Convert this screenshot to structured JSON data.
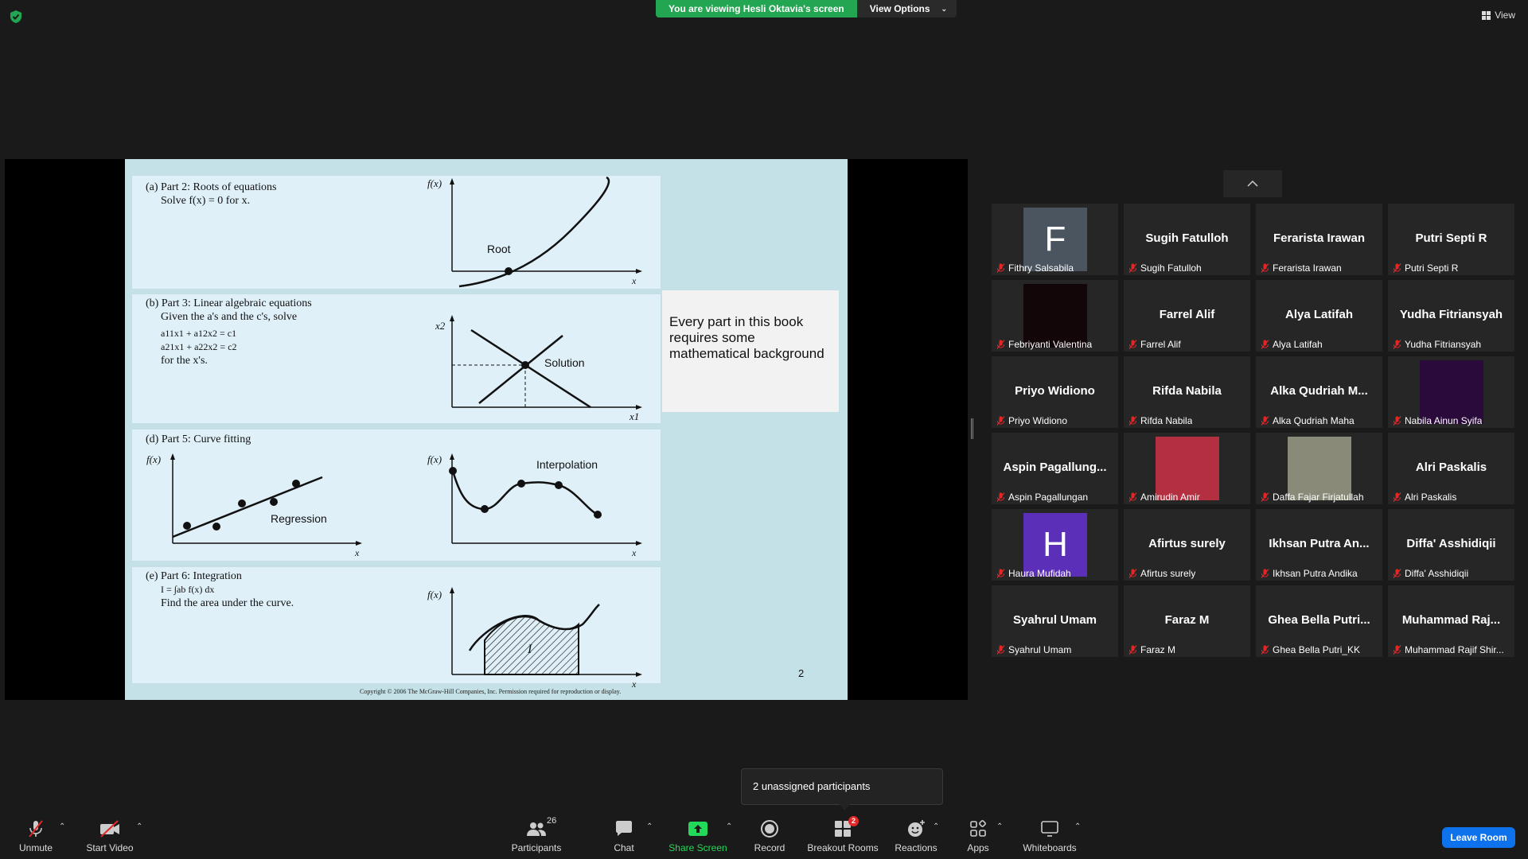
{
  "top": {
    "banner": "You are viewing Hesli Oktavia's screen",
    "view_options": "View Options",
    "view": "View"
  },
  "slide": {
    "part_a_title": "(a) Part 2: Roots of equations",
    "part_a_body": "Solve f(x) = 0 for x.",
    "part_a_label": "Root",
    "part_b_title": "(b) Part 3: Linear algebraic equations",
    "part_b_body1": "Given the a's and the c's, solve",
    "part_b_eq1": "a11x1 + a12x2 = c1",
    "part_b_eq2": "a21x1 + a22x2 = c2",
    "part_b_body2": "for the x's.",
    "part_b_label": "Solution",
    "part_d_title": "(d) Part 5: Curve fitting",
    "part_d_label_reg": "Regression",
    "part_d_label_int": "Interpolation",
    "part_e_title": "(e) Part 6: Integration",
    "part_e_eq": "I = ∫ab f(x) dx",
    "part_e_body": "Find the area under the curve.",
    "part_e_label": "I",
    "axis_fx": "f(x)",
    "axis_x": "x",
    "axis_x1": "x1",
    "axis_x2": "x2",
    "note": "Every part in this book requires some mathematical background",
    "page": "2",
    "copyright": "Copyright © 2006 The McGraw-Hill Companies, Inc.  Permission required for reproduction or display."
  },
  "participants": [
    {
      "big": "",
      "label": "Fithry Salsabila",
      "avatar": "F",
      "avatar_color": "#4a5560"
    },
    {
      "big": "Sugih Fatulloh",
      "label": "Sugih Fatulloh"
    },
    {
      "big": "Ferarista Irawan",
      "label": "Ferarista Irawan"
    },
    {
      "big": "Putri Septi R",
      "label": "Putri Septi R"
    },
    {
      "big": "",
      "label": "Febriyanti Valentina",
      "avatar": "",
      "avatar_color": "#120608"
    },
    {
      "big": "Farrel Alif",
      "label": "Farrel Alif"
    },
    {
      "big": "Alya Latifah",
      "label": "Alya Latifah"
    },
    {
      "big": "Yudha Fitriansyah",
      "label": "Yudha Fitriansyah"
    },
    {
      "big": "Priyo Widiono",
      "label": "Priyo Widiono"
    },
    {
      "big": "Rifda Nabila",
      "label": "Rifda Nabila"
    },
    {
      "big": "Alka Qudriah M...",
      "label": "Alka Qudriah Maha"
    },
    {
      "big": "",
      "label": "Nabila Ainun Syifa",
      "avatar": "",
      "avatar_color": "#2a0a3a"
    },
    {
      "big": "Aspin Pagallung...",
      "label": "Aspin Pagallungan"
    },
    {
      "big": "",
      "label": "Amirudin Amir",
      "avatar": "",
      "avatar_color": "#b43040"
    },
    {
      "big": "",
      "label": "Daffa Fajar Firjatullah",
      "avatar": "",
      "avatar_color": "#8a8a78"
    },
    {
      "big": "Alri Paskalis",
      "label": "Alri Paskalis"
    },
    {
      "big": "",
      "label": "Haura Mufidah",
      "avatar": "H",
      "avatar_color": "#5b2fb8"
    },
    {
      "big": "Afirtus surely",
      "label": "Afirtus surely"
    },
    {
      "big": "Ikhsan Putra An...",
      "label": "Ikhsan Putra Andika"
    },
    {
      "big": "Diffa' Asshidiqii",
      "label": "Diffa' Asshidiqii"
    },
    {
      "big": "Syahrul Umam",
      "label": "Syahrul Umam"
    },
    {
      "big": "Faraz M",
      "label": "Faraz M"
    },
    {
      "big": "Ghea Bella Putri...",
      "label": "Ghea Bella Putri_KK"
    },
    {
      "big": "Muhammad  Raj...",
      "label": "Muhammad Rajif Shir..."
    }
  ],
  "tooltip": "2 unassigned participants",
  "toolbar": {
    "unmute": "Unmute",
    "start_video": "Start Video",
    "participants": "Participants",
    "participants_count": "26",
    "chat": "Chat",
    "share_screen": "Share Screen",
    "record": "Record",
    "breakout_rooms": "Breakout Rooms",
    "breakout_badge": "2",
    "reactions": "Reactions",
    "apps": "Apps",
    "whiteboards": "Whiteboards",
    "leave_room": "Leave Room"
  },
  "colors": {
    "banner_green": "#23a651",
    "share_green": "#23d959",
    "leave_blue": "#0e72ed",
    "mute_red": "#e02828"
  }
}
